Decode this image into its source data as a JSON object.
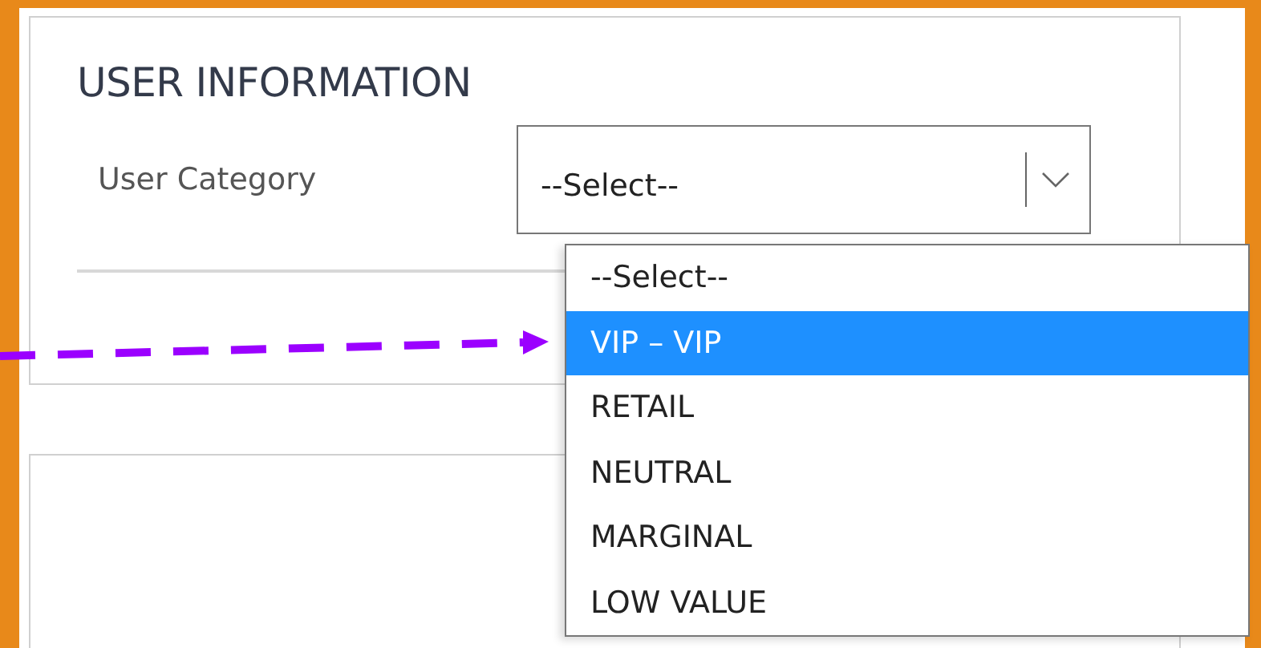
{
  "section": {
    "title": "USER INFORMATION",
    "field": {
      "label": "User Category",
      "value": "--Select--",
      "expanded": true
    }
  },
  "options": [
    {
      "label": "--Select--",
      "selected": false
    },
    {
      "label": "VIP – VIP",
      "selected": true
    },
    {
      "label": "RETAIL",
      "selected": false
    },
    {
      "label": "NEUTRAL",
      "selected": false
    },
    {
      "label": "MARGINAL",
      "selected": false
    },
    {
      "label": "LOW VALUE",
      "selected": false
    }
  ]
}
